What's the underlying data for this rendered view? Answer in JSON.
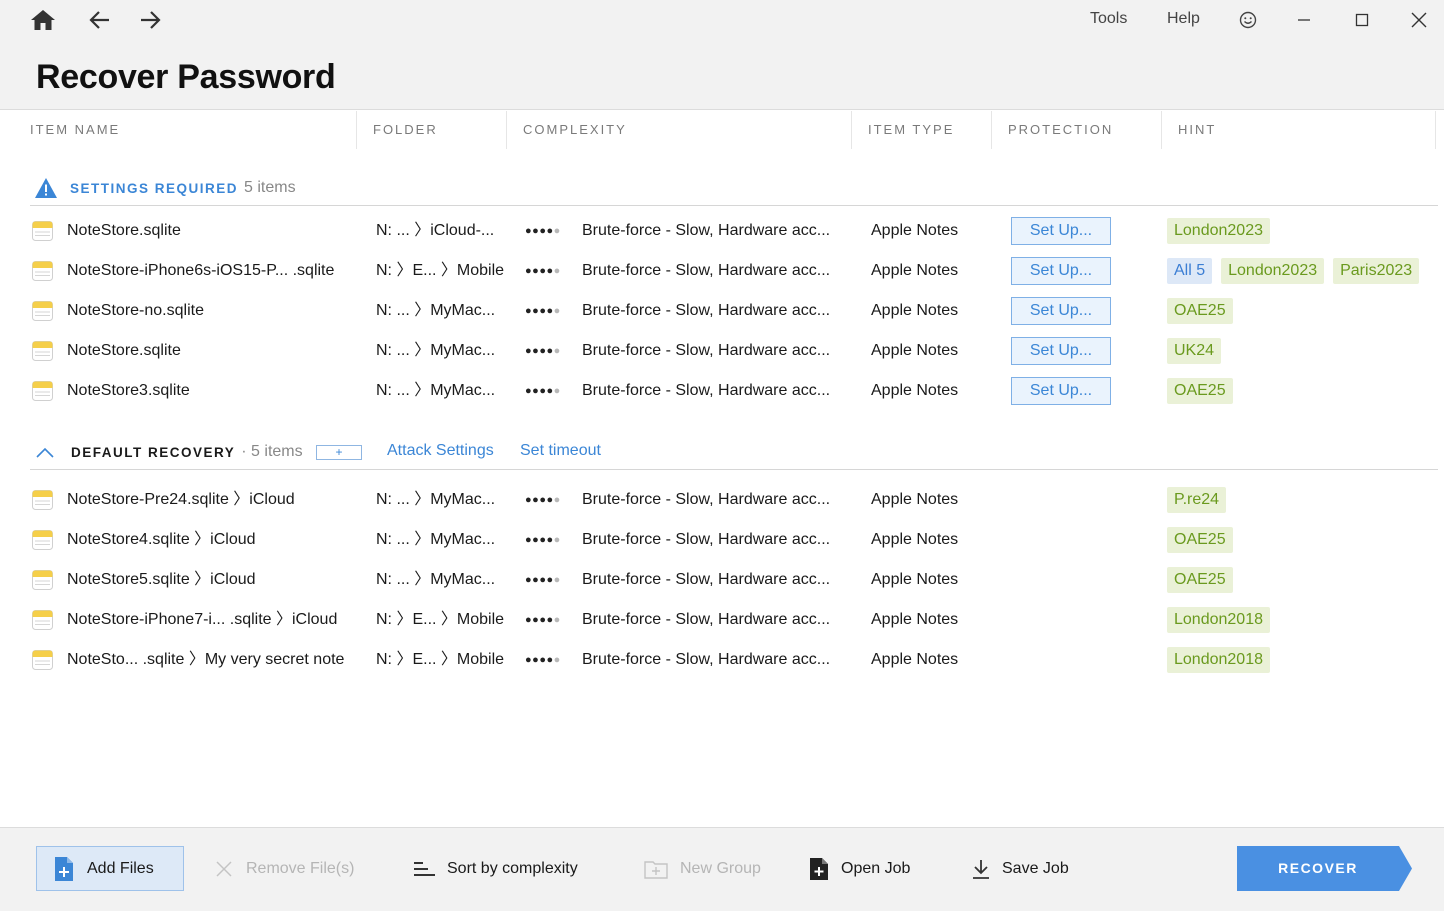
{
  "window": {
    "menu": {
      "tools": "Tools",
      "help": "Help"
    }
  },
  "page": {
    "title": "Recover Password"
  },
  "columns": [
    "ITEM NAME",
    "FOLDER",
    "COMPLEXITY",
    "ITEM TYPE",
    "PROTECTION",
    "HINT"
  ],
  "groups": {
    "settings_required": {
      "title": "SETTINGS REQUIRED",
      "count": "5 items",
      "rows": [
        {
          "name": "NoteStore.sqlite",
          "folder": "N: ... 〉iCloud-...",
          "complexity": "Brute-force - Slow, Hardware acc...",
          "type": "Apple Notes",
          "protection": "Set Up...",
          "hints": [
            "London2023"
          ]
        },
        {
          "name": "NoteStore-iPhone6s-iOS15-P... .sqlite",
          "folder": "N: 〉E...   〉Mobile",
          "complexity": "Brute-force - Slow, Hardware acc...",
          "type": "Apple Notes",
          "protection": "Set Up...",
          "hints_all": "All 5",
          "hints": [
            "London2023",
            "Paris2023"
          ]
        },
        {
          "name": "NoteStore-no.sqlite",
          "folder": "N: ... 〉MyMac...",
          "complexity": "Brute-force - Slow, Hardware acc...",
          "type": "Apple Notes",
          "protection": "Set Up...",
          "hints": [
            "OAE25"
          ]
        },
        {
          "name": "NoteStore.sqlite",
          "folder": "N: ... 〉MyMac...",
          "complexity": "Brute-force - Slow, Hardware acc...",
          "type": "Apple Notes",
          "protection": "Set Up...",
          "hints": [
            "UK24"
          ]
        },
        {
          "name": "NoteStore3.sqlite",
          "folder": "N: ... 〉MyMac...",
          "complexity": "Brute-force - Slow, Hardware acc...",
          "type": "Apple Notes",
          "protection": "Set Up...",
          "hints": [
            "OAE25"
          ]
        }
      ]
    },
    "default_recovery": {
      "title": "DEFAULT RECOVERY",
      "count": "· 5 items",
      "add": "+",
      "attack_settings": "Attack Settings",
      "set_timeout": "Set timeout",
      "rows": [
        {
          "name": "NoteStore-Pre24.sqlite 〉iCloud",
          "folder": "N: ... 〉MyMac...",
          "complexity": "Brute-force - Slow, Hardware acc...",
          "type": "Apple Notes",
          "hints": [
            "P.re24"
          ]
        },
        {
          "name": "NoteStore4.sqlite 〉iCloud",
          "folder": "N: ... 〉MyMac...",
          "complexity": "Brute-force - Slow, Hardware acc...",
          "type": "Apple Notes",
          "hints": [
            "OAE25"
          ]
        },
        {
          "name": "NoteStore5.sqlite 〉iCloud",
          "folder": "N: ... 〉MyMac...",
          "complexity": "Brute-force - Slow, Hardware acc...",
          "type": "Apple Notes",
          "hints": [
            "OAE25"
          ]
        },
        {
          "name": "NoteStore-iPhone7-i...  .sqlite 〉iCloud",
          "folder": "N: 〉E...   〉Mobile",
          "complexity": "Brute-force - Slow, Hardware acc...",
          "type": "Apple Notes",
          "hints": [
            "London2018"
          ]
        },
        {
          "name": "NoteSto... .sqlite 〉My very secret note",
          "folder": "N: 〉E...   〉Mobile",
          "complexity": "Brute-force - Slow, Hardware acc...",
          "type": "Apple Notes",
          "hints": [
            "London2018"
          ]
        }
      ]
    }
  },
  "complexity_level": {
    "filled": 4,
    "of": 5
  },
  "footer": {
    "add_files": "Add Files",
    "remove_files": "Remove File(s)",
    "sort": "Sort by complexity",
    "new_group": "New Group",
    "open_job": "Open Job",
    "save_job": "Save Job",
    "recover": "RECOVER"
  },
  "colors": {
    "accent": "#3b86d6",
    "recover_button": "#4a90e2",
    "hint_tag_bg": "#eaf1d7",
    "hint_tag_text": "#6a9a1e",
    "warning": "#3b86d6"
  }
}
